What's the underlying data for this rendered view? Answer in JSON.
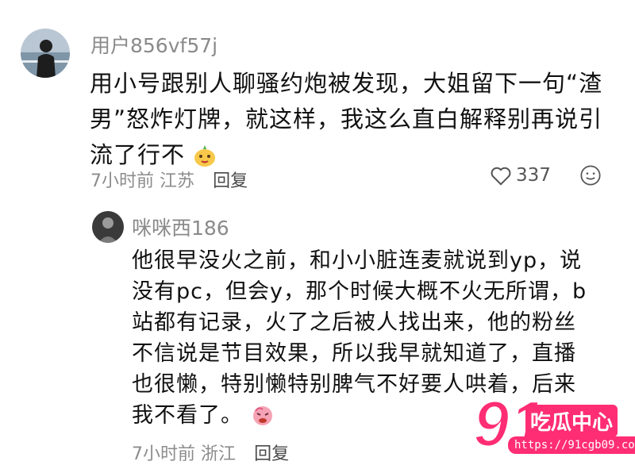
{
  "comment": {
    "username": "用户856vf57j",
    "lines": [
      "用小号跟别人聊骚约炮被发现，大姐留下一句“渣",
      "男”怒炸灯牌，就这样，我这么直白解释别再说引",
      "流了行不"
    ],
    "time_location": "7小时前 江苏",
    "reply_label": "回复",
    "likes": "337"
  },
  "reply": {
    "username": "咪咪西186",
    "lines": [
      "他很早没火之前，和小小脏连麦就说到yp，说",
      "没有pc，但会y，那个时候大概不火无所谓，b",
      "站都有记录，火了之后被人找出来，他的粉丝",
      "不信说是节目效果，所以我早就知道了，直播",
      "也很懒，特别懒特别脾气不好要人哄着，后来",
      "我不看了。"
    ],
    "time_location": "7小时前 浙江",
    "reply_label": "回复"
  },
  "watermark": {
    "number": "91",
    "name": "吃瓜中心",
    "url": "https://91cgb09.com"
  },
  "icons": [
    "heart-icon",
    "smiley-icon",
    "emoji-sticker-icon"
  ]
}
